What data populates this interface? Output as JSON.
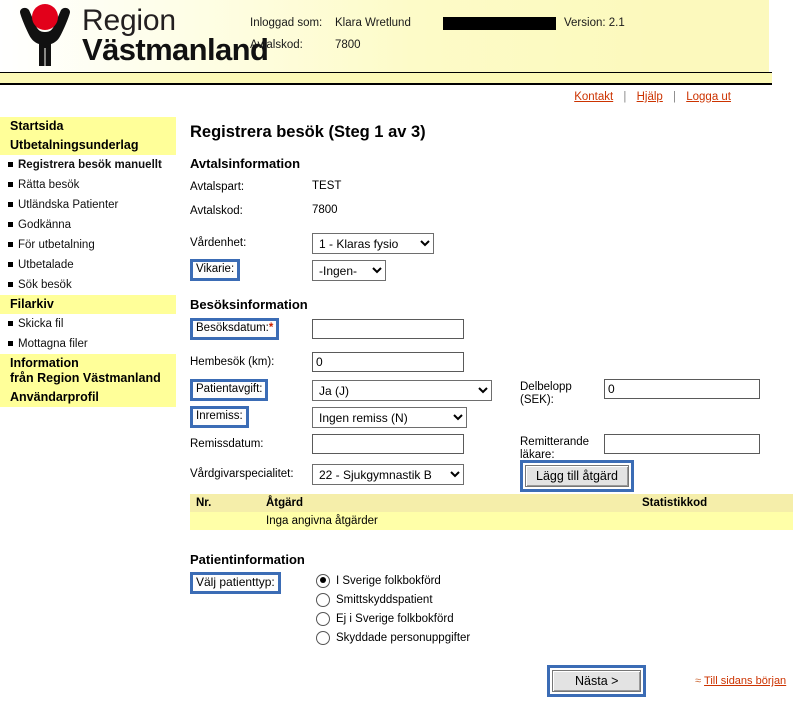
{
  "header": {
    "logo_region": "Region",
    "logo_name": "Västmanland",
    "logo_icon": "person-figure-logo",
    "login_label": "Inloggad som:",
    "login_user": "Klara Wretlund",
    "redacted_note": "",
    "version": "Version: 2.1",
    "avtalskod_label": "Avtalskod:",
    "avtalskod_value": "7800"
  },
  "toplinks": {
    "kontakt": "Kontakt",
    "hjalp": "Hjälp",
    "logga_ut": "Logga ut",
    "separator": "|"
  },
  "sidebar": {
    "groups": [
      {
        "header": "Startsida",
        "items": []
      },
      {
        "header": "Utbetalningsunderlag",
        "items": [
          "Registrera besök manuellt",
          "Rätta besök",
          "Utländska Patienter",
          "Godkänna",
          "För utbetalning",
          "Utbetalade",
          "Sök besök"
        ]
      },
      {
        "header": "Filarkiv",
        "items": [
          "Skicka fil",
          "Mottagna filer"
        ]
      },
      {
        "header": "Information\nfrån Region Västmanland",
        "items": []
      },
      {
        "header": "Användarprofil",
        "items": []
      }
    ]
  },
  "main": {
    "title": "Registrera besök (Steg 1 av 3)",
    "avtal": {
      "section_title": "Avtalsinformation",
      "avtalspart_label": "Avtalspart:",
      "avtalspart_value": "TEST",
      "avtalskod_label": "Avtalskod:",
      "avtalskod_value": "7800",
      "vardenhet_label": "Vårdenhet:",
      "vardenhet_value": "1 - Klaras fysio",
      "vikarie_label": "Vikarie:",
      "vikarie_value": "-Ingen-"
    },
    "besok": {
      "section_title": "Besöksinformation",
      "besoksdatum_label": "Besöksdatum:",
      "besoksdatum_req": "*",
      "besoksdatum_value": "",
      "hembesok_label": "Hembesök (km):",
      "hembesok_value": "0",
      "patientavgift_label": "Patientavgift:",
      "patientavgift_value": "Ja (J)",
      "delbelopp_label": "Delbelopp (SEK):",
      "delbelopp_value": "0",
      "inremiss_label": "Inremiss:",
      "inremiss_value": "Ingen remiss (N)",
      "remissdatum_label": "Remissdatum:",
      "remissdatum_value": "",
      "remitterande_label": "Remitterande läkare:",
      "remitterande_value": "",
      "specialitet_label": "Vårdgivarspecialitet:",
      "specialitet_value": "22 - Sjukgymnastik B",
      "add_atgard_button": "Lägg till åtgärd"
    },
    "atgard_table": {
      "columns": [
        "Nr.",
        "Åtgärd",
        "Statistikkod"
      ],
      "empty_message": "Inga angivna åtgärder"
    },
    "patient": {
      "section_title": "Patientinformation",
      "valj_label": "Välj patienttyp:",
      "options": [
        {
          "label": "I Sverige folkbokförd",
          "selected": true
        },
        {
          "label": "Smittskyddspatient",
          "selected": false
        },
        {
          "label": "Ej i Sverige folkbokförd",
          "selected": false
        },
        {
          "label": "Skyddade personuppgifter",
          "selected": false
        }
      ]
    },
    "footer": {
      "next_button": "Nästa >",
      "back_to_top": "Till sidans början",
      "back_chevron": "≈"
    }
  },
  "colors": {
    "highlight_blue": "#3b6cb5",
    "sidebar_yellow": "#ffff99",
    "table_yellow": "#ffffa8",
    "link_red": "#cc3300",
    "logo_red": "#e2001a",
    "header_yellow": "#fcf9bd"
  }
}
